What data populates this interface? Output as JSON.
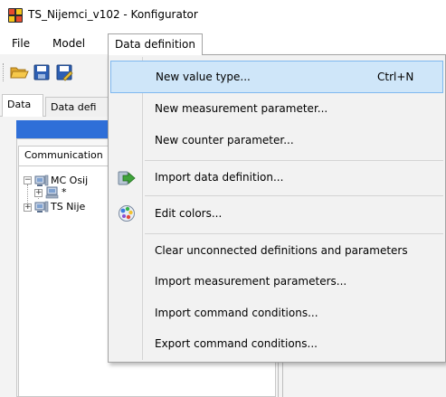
{
  "window": {
    "title": "TS_Nijemci_v102 - Konfigurator",
    "app_icon": "grid-app-icon"
  },
  "menubar": {
    "items": [
      "File",
      "Model",
      "Data definition"
    ]
  },
  "toolbar": {
    "buttons": [
      "open-folder-icon",
      "save-icon",
      "save-as-icon"
    ]
  },
  "tabs": {
    "data": "Data",
    "data_definition": "Data defi"
  },
  "left_panel": {
    "subtab": "Communication",
    "tree": [
      {
        "label": "MC Osij",
        "expander": "−",
        "icon": "network-node-icon"
      },
      {
        "label": "*",
        "expander": "+",
        "icon": "computer-icon"
      },
      {
        "label": "TS Nije",
        "expander": "+",
        "icon": "network-node-icon"
      }
    ]
  },
  "dropdown": {
    "items": [
      {
        "label": "New value type...",
        "shortcut": "Ctrl+N",
        "icon": "",
        "highlighted": true
      },
      {
        "label": "New measurement parameter...",
        "shortcut": "",
        "icon": ""
      },
      {
        "label": "New counter parameter...",
        "shortcut": "",
        "icon": ""
      },
      {
        "label": "Import data definition...",
        "shortcut": "",
        "icon": "green-arrow-import-icon"
      },
      {
        "label": "Edit colors...",
        "shortcut": "",
        "icon": "color-palette-icon"
      },
      {
        "label": "Clear unconnected definitions and parameters",
        "shortcut": "",
        "icon": ""
      },
      {
        "label": "Import measurement parameters...",
        "shortcut": "",
        "icon": ""
      },
      {
        "label": "Import command conditions...",
        "shortcut": "",
        "icon": ""
      },
      {
        "label": "Export command conditions...",
        "shortcut": "",
        "icon": ""
      }
    ]
  },
  "colors": {
    "highlight_bg": "#cfe6f9",
    "highlight_border": "#7fb8ef",
    "panel_header": "#2f6fd8",
    "menu_bg": "#f2f2f2"
  }
}
